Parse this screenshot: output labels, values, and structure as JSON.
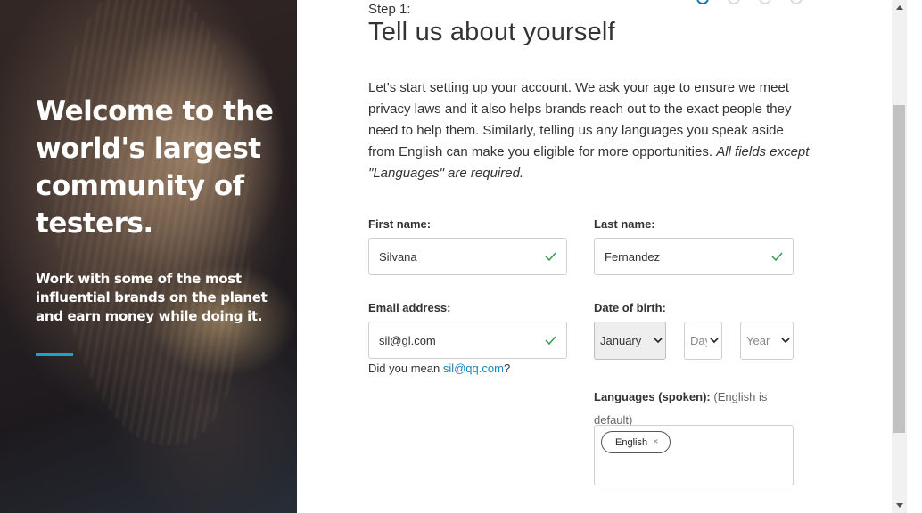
{
  "hero": {
    "title": "Welcome to the world's largest community of testers.",
    "subtitle": "Work with some of the most influential brands on the planet and earn money while doing it.",
    "accent_color": "#1aa4c9"
  },
  "progress": {
    "total_steps": 4,
    "current_step": 1
  },
  "form": {
    "step_label": "Step 1:",
    "title": "Tell us about yourself",
    "intro": "Let's start setting up your account. We ask your age to ensure we meet privacy laws and it also helps brands reach out to the exact people they need to help them. Similarly, telling us any languages you speak aside from English can make you eligible for more opportunities.",
    "intro_note": "All fields except \"Languages\" are required.",
    "first_name": {
      "label": "First name:",
      "value": "Silvana",
      "status_icon": "check-icon"
    },
    "last_name": {
      "label": "Last name:",
      "value": "Fernandez",
      "status_icon": "check-icon"
    },
    "email": {
      "label": "Email address:",
      "value": "sil@gl.com",
      "status_icon": "check-icon"
    },
    "email_suggestion": {
      "prefix": "Did you mean ",
      "link": "sil@qq.com",
      "suffix": "?"
    },
    "dob": {
      "label": "Date of birth:",
      "month": "January",
      "day_placeholder": "Day",
      "year_placeholder": "Year"
    },
    "languages": {
      "label": "Languages (spoken):",
      "hint_line1": "(English is",
      "hint_line2": "default)",
      "selected": [
        "English"
      ],
      "remove_glyph": "×"
    }
  },
  "colors": {
    "valid": "#2e9b4f",
    "link": "#1a86b8",
    "step_active": "#1877a8"
  }
}
